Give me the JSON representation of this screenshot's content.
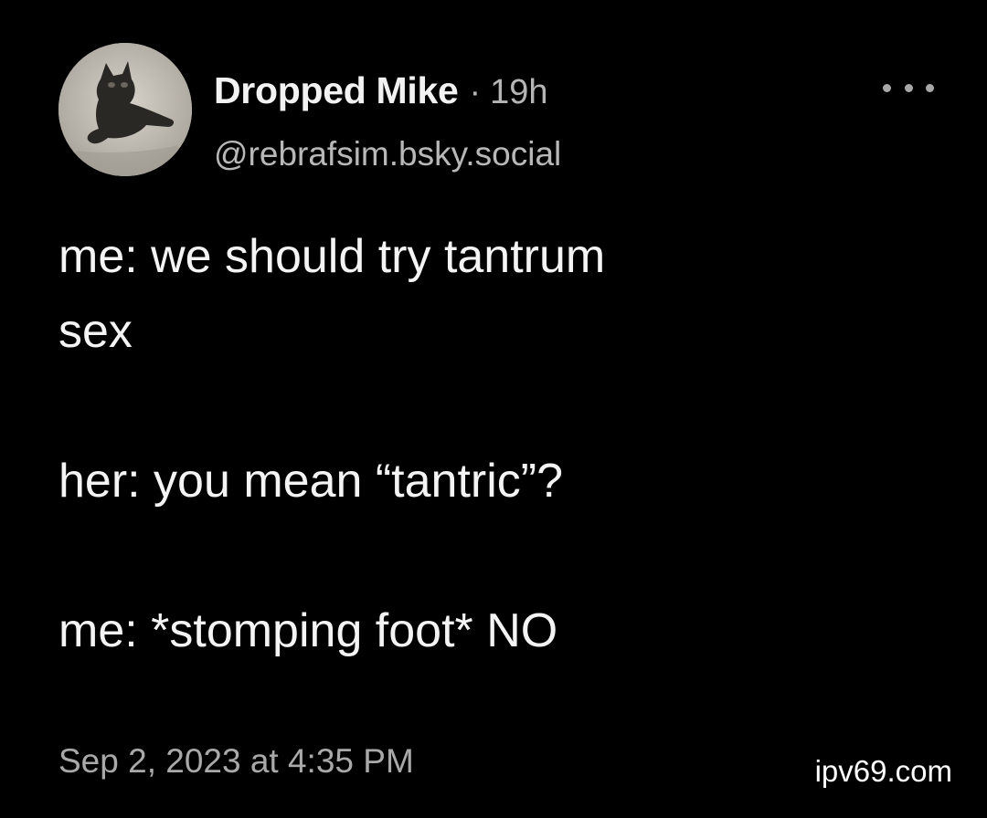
{
  "post": {
    "author": {
      "display_name": "Dropped Mike",
      "separator": "·",
      "time_ago": "19h",
      "handle": "@rebrafsim.bsky.social"
    },
    "body_lines": [
      "me: we should try tantrum",
      "sex",
      "",
      "her: you mean “tantric”?",
      "",
      "me: *stomping foot* NO"
    ],
    "timestamp": "Sep 2, 2023 at 4:35 PM",
    "more_icon": "more-horizontal-icon",
    "avatar_icon": "cat-photo-avatar"
  },
  "watermark": "ipv69.com",
  "colors": {
    "background": "#000000",
    "text_primary": "#f2f2f2",
    "text_secondary": "#b5b5b5"
  }
}
